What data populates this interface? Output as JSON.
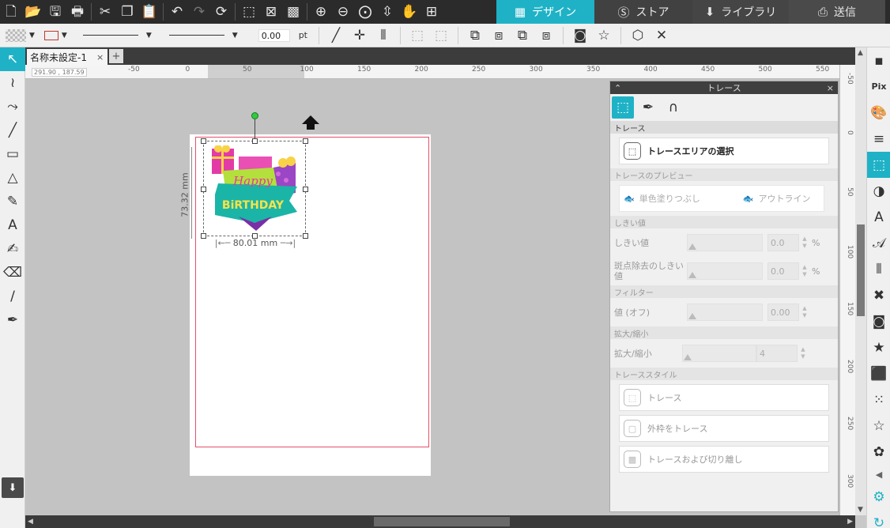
{
  "nav": {
    "tabs": [
      {
        "label": "デザイン",
        "icon": "grid-icon",
        "active": true
      },
      {
        "label": "ストア",
        "icon": "store-icon",
        "active": false
      },
      {
        "label": "ライブラリ",
        "icon": "library-icon",
        "active": false
      },
      {
        "label": "送信",
        "icon": "send-icon",
        "active": false
      }
    ]
  },
  "options": {
    "line_width": "0.00",
    "unit": "pt",
    "line_color": "#c0392b"
  },
  "document": {
    "tab_title": "名称未設定-1",
    "close": "×",
    "add_tab": "+"
  },
  "ruler": {
    "coords": "291.90 , 187.59",
    "h_labels": [
      "-50",
      "0",
      "50",
      "100",
      "150",
      "200",
      "250",
      "300",
      "350",
      "400",
      "450",
      "500",
      "550"
    ],
    "v_labels": [
      "-50",
      "0",
      "50",
      "100",
      "150",
      "200",
      "250",
      "300"
    ]
  },
  "selection": {
    "width": "80.01 mm",
    "height": "73.32 mm"
  },
  "artwork": {
    "text1": "Happy",
    "text2": "BiRTHDAY"
  },
  "panel": {
    "title": "トレース",
    "close": "×",
    "sections": {
      "trace": "トレース",
      "preview": "トレースのプレビュー",
      "threshold": "しきい値",
      "filter": "フィルター",
      "scale": "拡大/縮小",
      "style": "トレーススタイル"
    },
    "select_area": "トレースエリアの選択",
    "preview_fill": "単色塗りつぶし",
    "preview_outline": "アウトライン",
    "threshold_label": "しきい値",
    "threshold_value": "0.0",
    "speck_label": "斑点除去のしきい値",
    "speck_value": "0.0",
    "percent": "%",
    "filter_label": "値 (オフ)",
    "filter_value": "0.00",
    "scale_label": "拡大/縮小",
    "scale_value": "4",
    "style_trace": "トレース",
    "style_outer": "外枠をトレース",
    "style_detach": "トレースおよび切り離し"
  },
  "colors": {
    "accent": "#1fb2c6",
    "toolbar_dark": "#2b2b2b",
    "cut_line": "#e3506a"
  }
}
